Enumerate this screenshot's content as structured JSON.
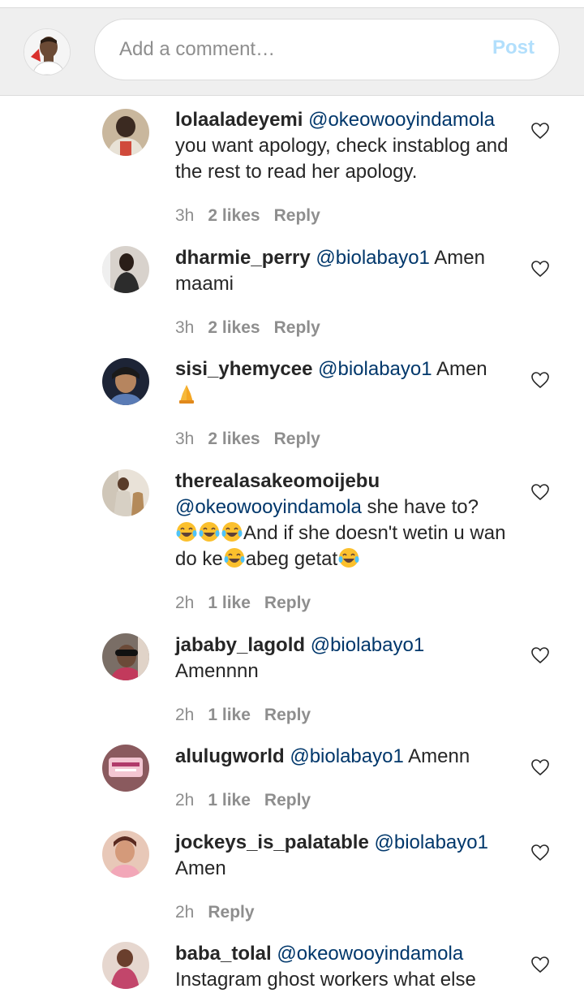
{
  "composer": {
    "placeholder": "Add a comment…",
    "post_label": "Post"
  },
  "comments": [
    {
      "username": "lolaaladeyemi",
      "mention": "@okeowooyindamola",
      "text": "you want apology, check instablog and the rest to read her apology.",
      "time": "3h",
      "likes": "2 likes",
      "reply": "Reply"
    },
    {
      "username": "dharmie_perry",
      "mention": "@biolabayo1",
      "text": "Amen maami",
      "time": "3h",
      "likes": "2 likes",
      "reply": "Reply"
    },
    {
      "username": "sisi_yhemycee",
      "mention": "@biolabayo1",
      "text": "Amen",
      "time": "3h",
      "likes": "2 likes",
      "reply": "Reply"
    },
    {
      "username": "therealasakeomoijebu",
      "mention": "@okeowooyindamola",
      "text_a": "she have to?",
      "text_b": "And if she doesn't wetin u wan do ke",
      "text_c": "abeg getat",
      "time": "2h",
      "likes": "1 like",
      "reply": "Reply"
    },
    {
      "username": "jababy_lagold",
      "mention": "@biolabayo1",
      "text": "Amennnn",
      "time": "2h",
      "likes": "1 like",
      "reply": "Reply"
    },
    {
      "username": "alulugworld",
      "mention": "@biolabayo1",
      "text": "Amenn",
      "time": "2h",
      "likes": "1 like",
      "reply": "Reply"
    },
    {
      "username": "jockeys_is_palatable",
      "mention": "@biolabayo1",
      "text": "Amen",
      "time": "2h",
      "reply": "Reply"
    },
    {
      "username": "baba_tolal",
      "mention": "@okeowooyindamola",
      "text": "Instagram ghost workers what else"
    }
  ],
  "icons": {
    "heart": "heart-outline-icon",
    "pray": "folded-hands-emoji",
    "laugh": "tears-of-joy-emoji"
  }
}
